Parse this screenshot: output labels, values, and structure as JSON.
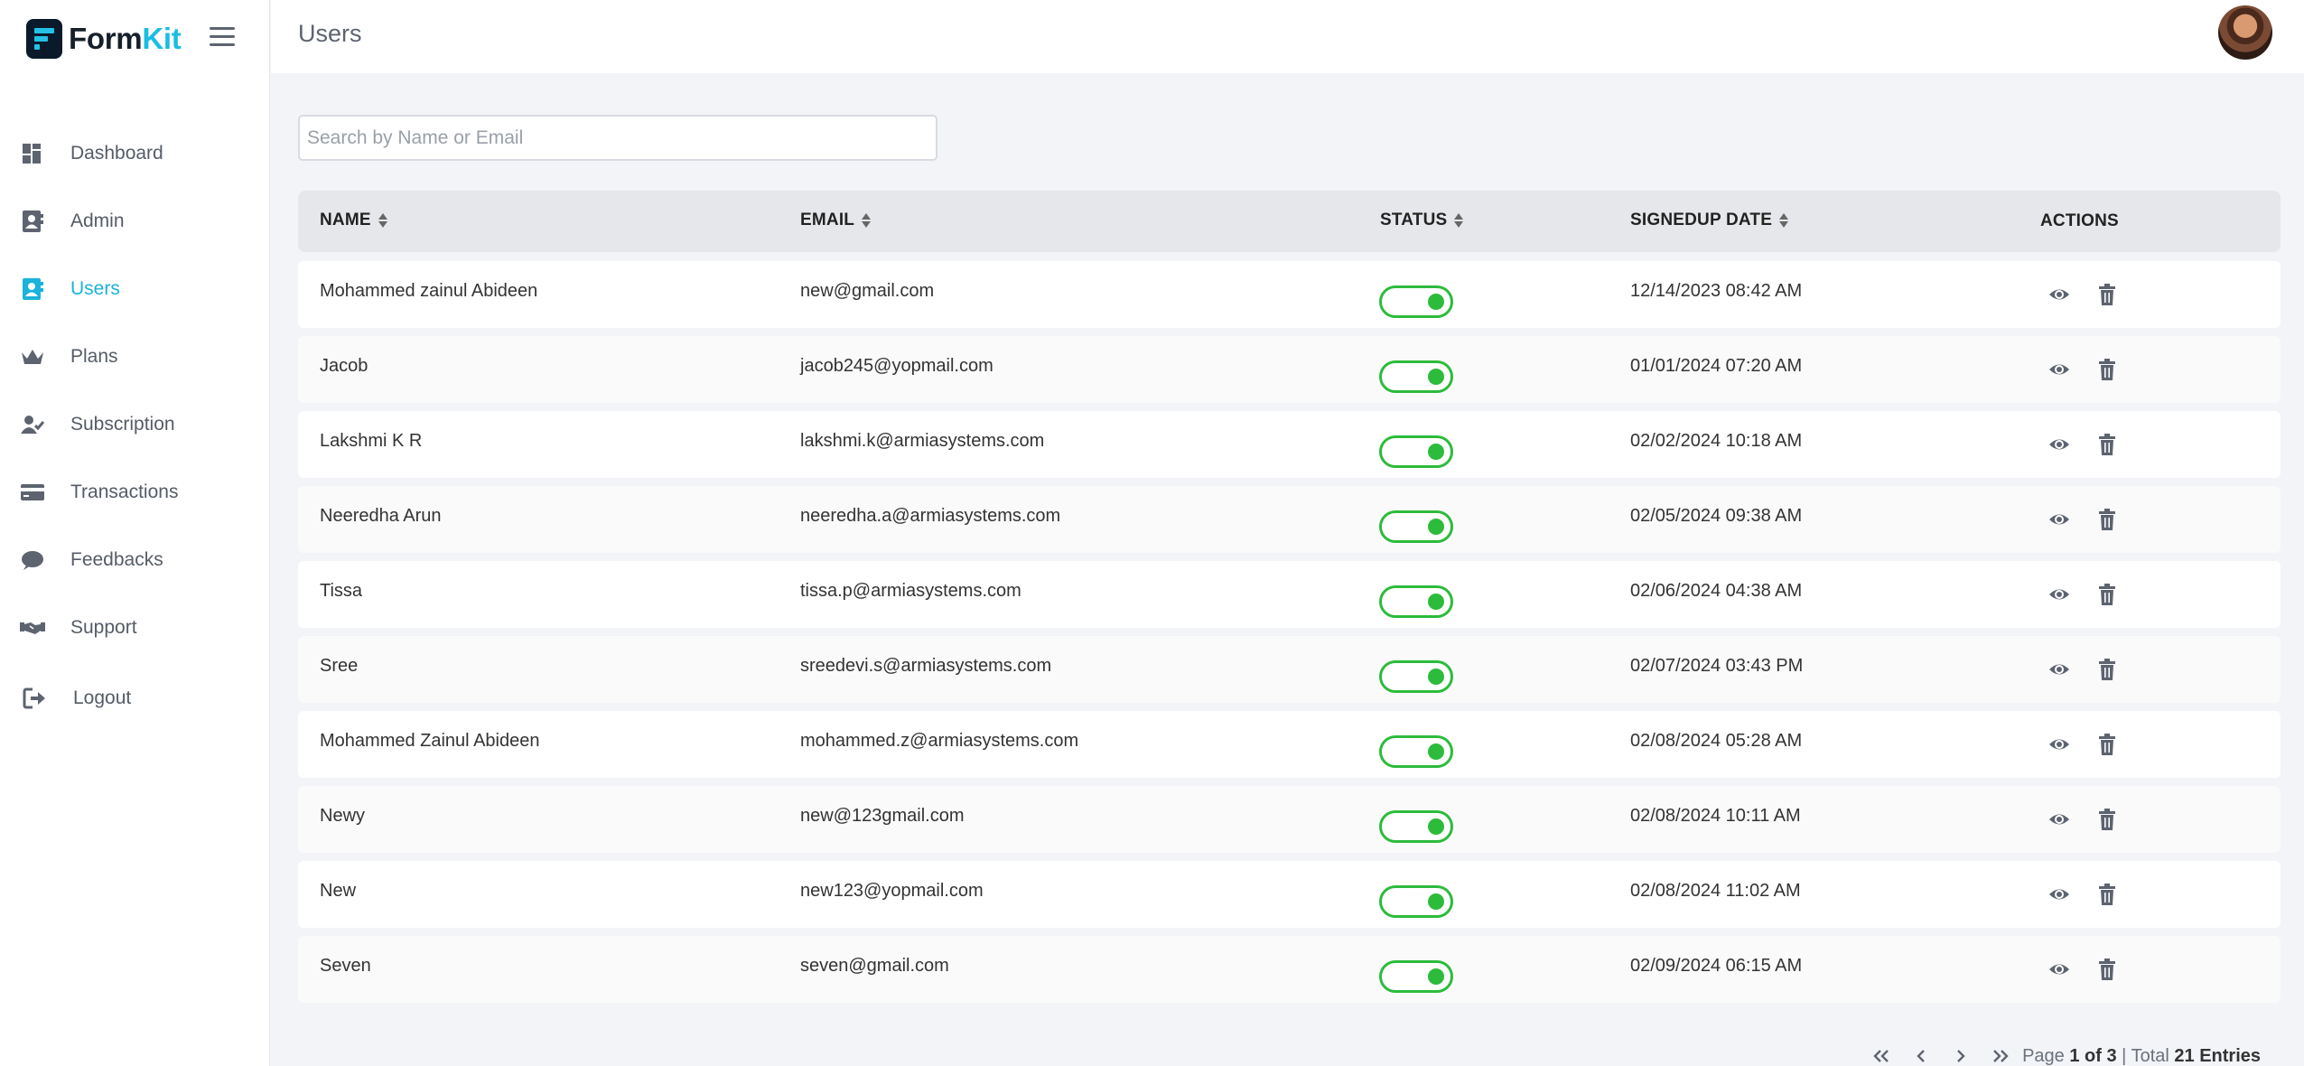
{
  "app": {
    "brand_a": "Form",
    "brand_b": "Kit",
    "page_title": "Users",
    "accent_color": "#1ab3dc",
    "toggle_color": "#2dbb3c"
  },
  "sidebar": {
    "items": [
      {
        "label": "Dashboard",
        "icon": "dashboard-icon"
      },
      {
        "label": "Admin",
        "icon": "admin-contact-icon"
      },
      {
        "label": "Users",
        "icon": "users-contact-icon",
        "active": true
      },
      {
        "label": "Plans",
        "icon": "crown-icon"
      },
      {
        "label": "Subscription",
        "icon": "user-check-icon"
      },
      {
        "label": "Transactions",
        "icon": "credit-card-icon"
      },
      {
        "label": "Feedbacks",
        "icon": "chat-bubble-icon"
      },
      {
        "label": "Support",
        "icon": "handshake-icon"
      },
      {
        "label": "Logout",
        "icon": "logout-icon"
      }
    ]
  },
  "search": {
    "placeholder": "Search by Name or Email",
    "value": ""
  },
  "table": {
    "headers": {
      "name": "NAME",
      "email": "EMAIL",
      "status": "STATUS",
      "date": "SIGNEDUP DATE",
      "actions": "ACTIONS"
    },
    "rows": [
      {
        "name": "Mohammed zainul Abideen",
        "email": "new@gmail.com",
        "status": "on",
        "date": "12/14/2023 08:42 AM"
      },
      {
        "name": "Jacob",
        "email": "jacob245@yopmail.com",
        "status": "on",
        "date": "01/01/2024 07:20 AM"
      },
      {
        "name": "Lakshmi K R",
        "email": "lakshmi.k@armiasystems.com",
        "status": "on",
        "date": "02/02/2024 10:18 AM"
      },
      {
        "name": "Neeredha Arun",
        "email": "neeredha.a@armiasystems.com",
        "status": "on",
        "date": "02/05/2024 09:38 AM"
      },
      {
        "name": "Tissa",
        "email": "tissa.p@armiasystems.com",
        "status": "on",
        "date": "02/06/2024 04:38 AM"
      },
      {
        "name": "Sree",
        "email": "sreedevi.s@armiasystems.com",
        "status": "on",
        "date": "02/07/2024 03:43 PM"
      },
      {
        "name": "Mohammed Zainul Abideen",
        "email": "mohammed.z@armiasystems.com",
        "status": "on",
        "date": "02/08/2024 05:28 AM"
      },
      {
        "name": "Newy",
        "email": "new@123gmail.com",
        "status": "on",
        "date": "02/08/2024 10:11 AM"
      },
      {
        "name": "New",
        "email": "new123@yopmail.com",
        "status": "on",
        "date": "02/08/2024 11:02 AM"
      },
      {
        "name": "Seven",
        "email": "seven@gmail.com",
        "status": "on",
        "date": "02/09/2024 06:15 AM"
      }
    ]
  },
  "pagination": {
    "page_word": "Page",
    "page_value": "1 of 3",
    "separator": "|",
    "total_word": "Total",
    "total_value": "21 Entries"
  }
}
